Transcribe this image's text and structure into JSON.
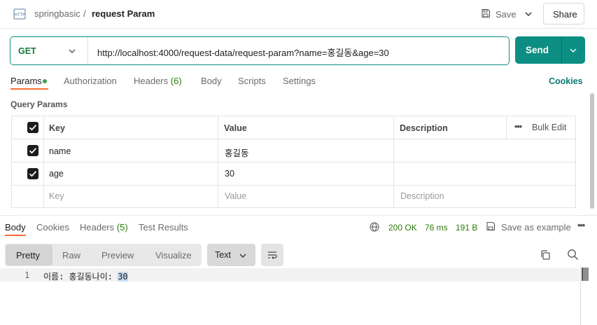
{
  "header": {
    "collection": "springbasic",
    "separator": "/",
    "request_name": "request Param",
    "save_label": "Save",
    "share_label": "Share"
  },
  "request": {
    "method": "GET",
    "url": "http://localhost:4000/request-data/request-param?name=홍길동&age=30",
    "send_label": "Send"
  },
  "tabs": {
    "params": "Params",
    "authorization": "Authorization",
    "headers": "Headers",
    "headers_count": "(6)",
    "body": "Body",
    "scripts": "Scripts",
    "settings": "Settings",
    "cookies": "Cookies"
  },
  "query_params": {
    "title": "Query Params",
    "columns": {
      "key": "Key",
      "value": "Value",
      "description": "Description",
      "bulk_edit": "Bulk Edit"
    },
    "rows": [
      {
        "key": "name",
        "value": "홍길동",
        "description": ""
      },
      {
        "key": "age",
        "value": "30",
        "description": ""
      }
    ],
    "placeholder": {
      "key": "Key",
      "value": "Value",
      "description": "Description"
    }
  },
  "response": {
    "tabs": {
      "body": "Body",
      "cookies": "Cookies",
      "headers": "Headers",
      "headers_count": "(5)",
      "test_results": "Test Results"
    },
    "status": "200 OK",
    "time": "76 ms",
    "size": "191 B",
    "save_example": "Save as example",
    "view_modes": [
      "Pretty",
      "Raw",
      "Preview",
      "Visualize"
    ],
    "format": "Text",
    "line_number": "1",
    "body_text": "이름: 홍길동나이: ",
    "body_highlight": "30"
  },
  "colors": {
    "accent": "#0c8f82",
    "status_ok": "#2b7a0b",
    "cookies_link": "#0c7a6e"
  }
}
